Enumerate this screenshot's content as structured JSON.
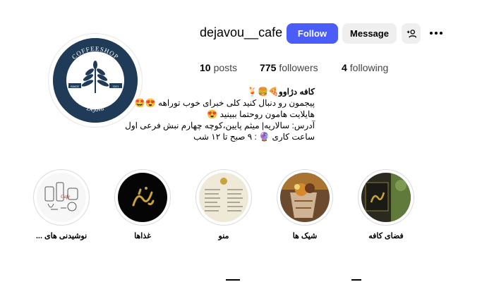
{
  "profile": {
    "username": "dejavou__cafe",
    "follow_label": "Follow",
    "message_label": "Message",
    "logo_top_text": "COFFEESHOP",
    "logo_bottom_text": "Dejavu",
    "logo_since": "SINCE",
    "logo_year": "2021"
  },
  "stats": {
    "posts_count": "10",
    "posts_label": "posts",
    "followers_count": "775",
    "followers_label": "followers",
    "following_count": "4",
    "following_label": "following"
  },
  "bio": {
    "name": "کافه دژاوو🍕🍔🍹",
    "line1": "پیجمون رو دنبال کنید کلی خبرای خوب توراهه 😍🤩",
    "line2": "هایلایت هامون روحتما ببینید 😍",
    "line3": "آدرس: سالاریه| میثم پایین،کوچه چهارم نبش فرعی اول",
    "line4": "ساعت کاری 🔮 : ۹ صبح تا ۱۲ شب"
  },
  "highlights": [
    {
      "label": "نوشیدنی های ..."
    },
    {
      "label": "غذاها"
    },
    {
      "label": "منو"
    },
    {
      "label": "شیک ها"
    },
    {
      "label": "فضای کافه"
    }
  ],
  "colors": {
    "follow_button": "#4a5df9",
    "secondary_button": "#efefef",
    "logo_background": "#1f3b57"
  },
  "icons": [
    "add-person-icon",
    "more-options-icon"
  ]
}
